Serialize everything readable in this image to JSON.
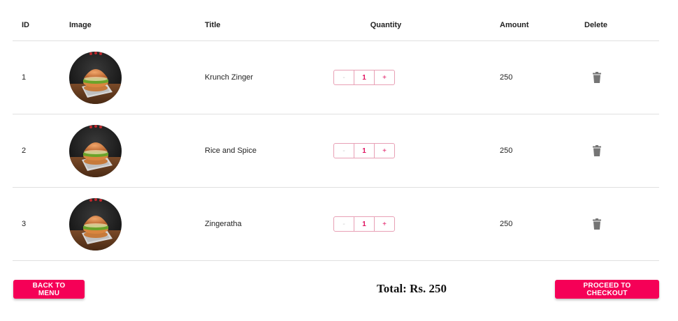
{
  "table": {
    "headers": {
      "id": "ID",
      "image": "Image",
      "title": "Title",
      "quantity": "Quantity",
      "amount": "Amount",
      "delete": "Delete"
    },
    "rows": [
      {
        "id": "1",
        "title": "Krunch Zinger",
        "quantity": "1",
        "minus": "-",
        "plus": "+",
        "amount": "250"
      },
      {
        "id": "2",
        "title": "Rice and Spice",
        "quantity": "1",
        "minus": "-",
        "plus": "+",
        "amount": "250"
      },
      {
        "id": "3",
        "title": "Zingeratha",
        "quantity": "1",
        "minus": "-",
        "plus": "+",
        "amount": "250"
      }
    ]
  },
  "footer": {
    "back_label": "BACK TO MENU",
    "total_label": "Total: Rs. 250",
    "checkout_label": "PROCEED TO CHECKOUT"
  },
  "colors": {
    "accent": "#f50057",
    "trash_icon": "#757575",
    "divider": "#e0e0e0"
  },
  "icons": {
    "delete": "trash-icon"
  }
}
